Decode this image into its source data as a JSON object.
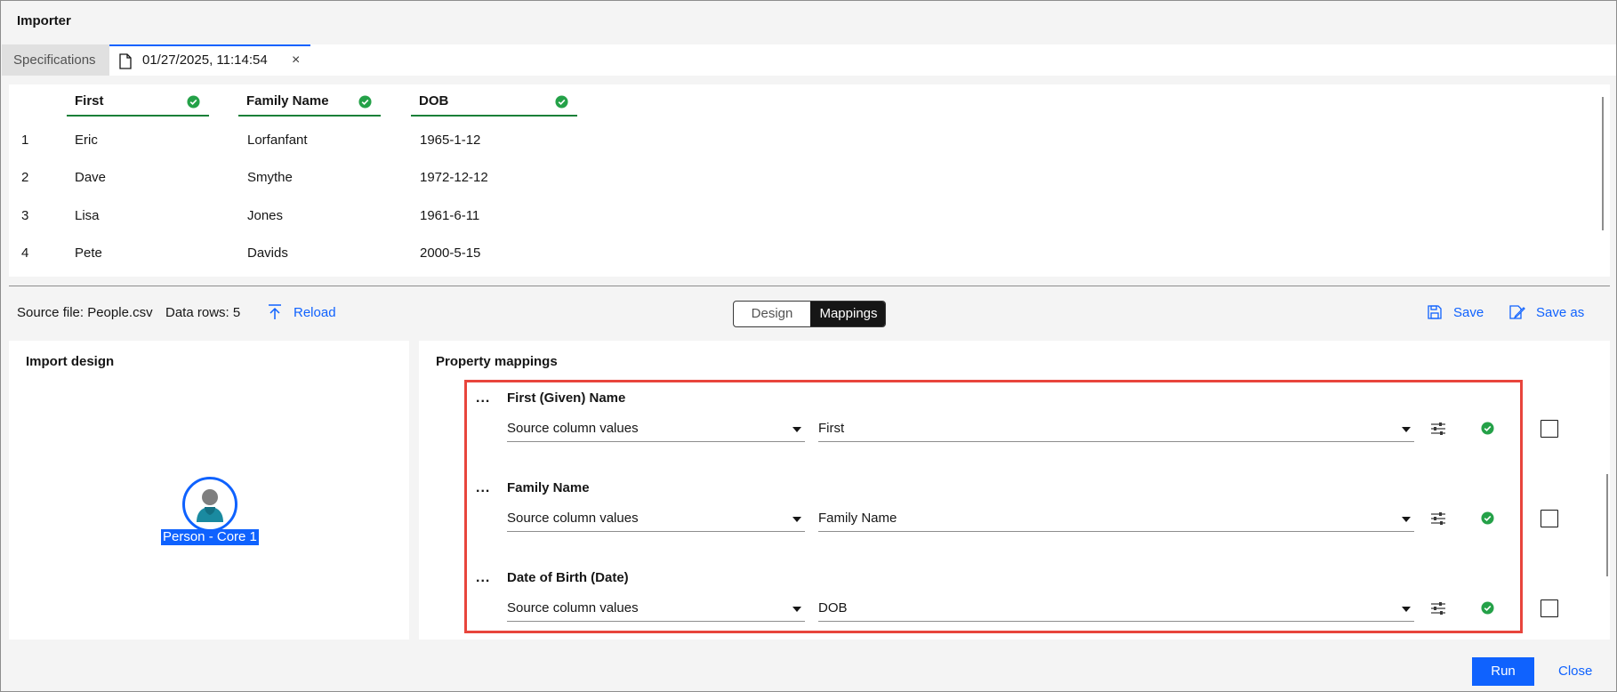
{
  "window": {
    "title": "Importer"
  },
  "tabs": {
    "specifications": "Specifications",
    "file": "01/27/2025, 11:14:54",
    "close_glyph": "×"
  },
  "grid": {
    "columns": [
      "First",
      "Family Name",
      "DOB"
    ],
    "rows": [
      {
        "num": "1",
        "cells": [
          "Eric",
          "Lorfanfant",
          "1965-1-12"
        ]
      },
      {
        "num": "2",
        "cells": [
          "Dave",
          "Smythe",
          "1972-12-12"
        ]
      },
      {
        "num": "3",
        "cells": [
          "Lisa",
          "Jones",
          "1961-6-11"
        ]
      },
      {
        "num": "4",
        "cells": [
          "Pete",
          "Davids",
          "2000-5-15"
        ]
      }
    ]
  },
  "info_bar": {
    "source_file": "Source file: People.csv",
    "data_rows": "Data rows: 5",
    "reload": "Reload",
    "design": "Design",
    "mappings": "Mappings",
    "active_view": "Mappings",
    "save": "Save",
    "save_as": "Save as"
  },
  "import_design": {
    "title": "Import design",
    "node_label": "Person - Core 1"
  },
  "property_mappings": {
    "title": "Property mappings",
    "more_glyph": "...",
    "rows": [
      {
        "label": "First (Given) Name",
        "mode": "Source column values",
        "column": "First",
        "checked": false
      },
      {
        "label": "Family Name",
        "mode": "Source column values",
        "column": "Family Name",
        "checked": false
      },
      {
        "label": "Date of Birth (Date)",
        "mode": "Source column values",
        "column": "DOB",
        "checked": false
      }
    ]
  },
  "footer": {
    "run": "Run",
    "close": "Close"
  },
  "colors": {
    "accent": "#0f62fe",
    "success": "#198038",
    "highlight": "#e8453c"
  }
}
